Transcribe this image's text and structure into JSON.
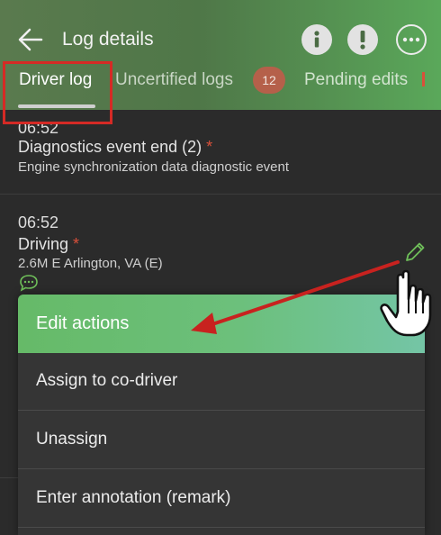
{
  "header": {
    "title": "Log details",
    "back_icon": "arrow-left-icon",
    "actions": [
      {
        "icon": "info-icon"
      },
      {
        "icon": "alert-icon"
      },
      {
        "icon": "more-horizontal-icon"
      }
    ]
  },
  "tabs": {
    "driver_log": "Driver log",
    "uncertified_logs": "Uncertified logs",
    "uncertified_count": "12",
    "pending_edits": "Pending edits"
  },
  "entries": [
    {
      "time": "06:52",
      "title": "Diagnostics event end (2)",
      "asterisk": "*",
      "subtitle": "Engine synchronization data diagnostic event"
    },
    {
      "time": "06:52",
      "title": "Driving",
      "asterisk": "*",
      "subtitle": "2.6M E Arlington, VA (E)"
    }
  ],
  "menu": {
    "header": "Edit actions",
    "items": [
      "Assign to co-driver",
      "Unassign",
      "Enter annotation (remark)"
    ]
  },
  "colors": {
    "accent_green": "#66ba68",
    "badge": "#b5604a",
    "asterisk_red": "#d9503a",
    "annotation_red": "#d52a25",
    "menu_bg": "#353535",
    "background": "#2b2b2b"
  }
}
